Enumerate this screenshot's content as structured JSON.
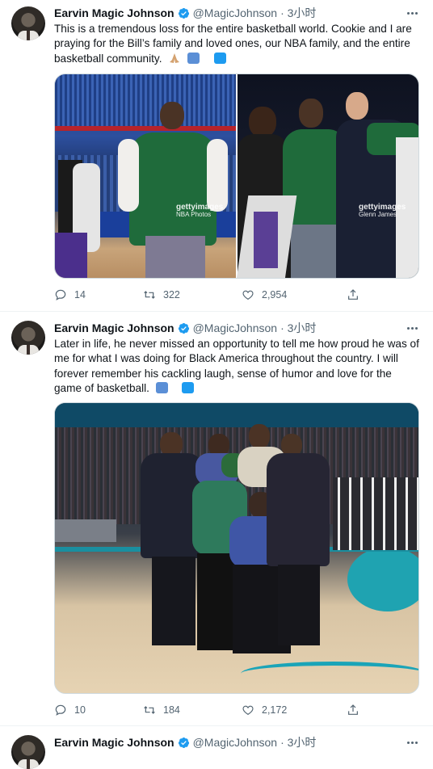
{
  "tweets": [
    {
      "author": "Earvin Magic Johnson",
      "handle": "@MagicJohnson",
      "time": "· 3小时",
      "text": "This is a tremendous loss for the entire basketball world. Cookie and I are praying for the Bill’s family and loved ones, our NBA family, and the entire basketball community.",
      "replies": "14",
      "retweets": "322",
      "likes": "2,954",
      "watermarks": [
        {
          "brand": "gettyimages",
          "credit": "NBA Photos"
        },
        {
          "brand": "gettyimages",
          "credit": "Glenn James"
        }
      ]
    },
    {
      "author": "Earvin Magic Johnson",
      "handle": "@MagicJohnson",
      "time": "· 3小时",
      "text": "Later in life, he never missed an opportunity to tell me how proud he was of me for what I was doing for Black America throughout the country. I will forever remember his cackling laugh, sense of humor and love for the game of basketball.",
      "replies": "10",
      "retweets": "184",
      "likes": "2,172"
    },
    {
      "author": "Earvin Magic Johnson",
      "handle": "@MagicJohnson",
      "time": "· 3小时"
    }
  ],
  "icons": {
    "verified": "verified-badge-icon",
    "reply": "reply-icon",
    "retweet": "retweet-icon",
    "like": "heart-icon",
    "share": "share-icon",
    "more": "more-dots-icon",
    "translate": "translate-icon"
  },
  "colors": {
    "verified": "#1d9bf0",
    "secondary_text": "#536471",
    "primary_text": "#0f1419"
  }
}
